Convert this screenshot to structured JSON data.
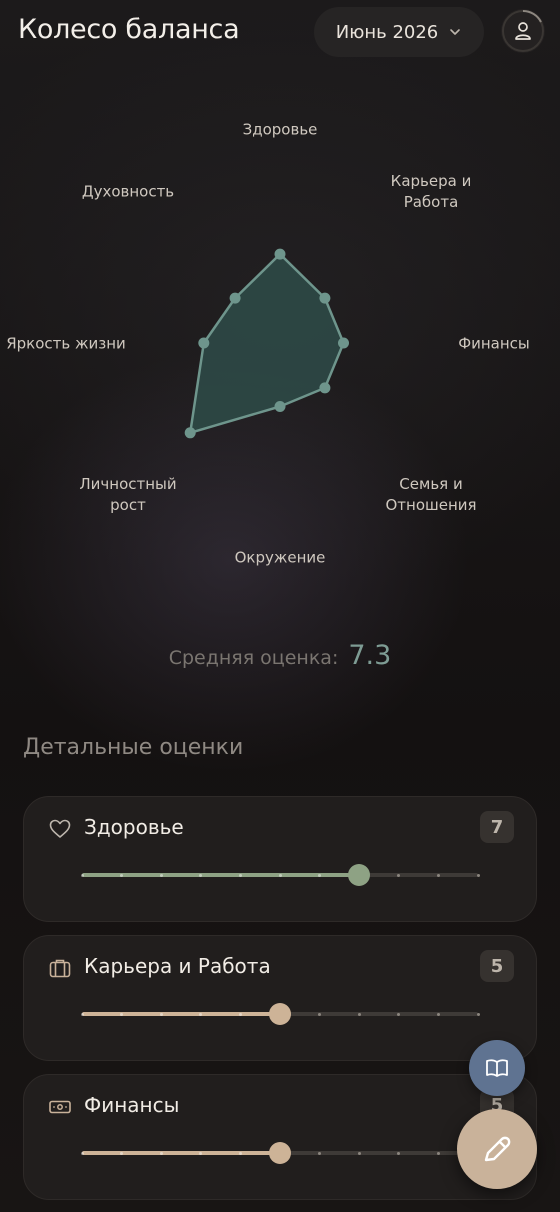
{
  "header": {
    "title": "Колесо баланса",
    "month": "Июнь 2026"
  },
  "radar": {
    "axes": [
      {
        "label": "Здоровье",
        "value": 7
      },
      {
        "label": "Карьера и\nРабота",
        "value": 5
      },
      {
        "label": "Финансы",
        "value": 5
      },
      {
        "label": "Семья и\nОтношения",
        "value": 5
      },
      {
        "label": "Окружение",
        "value": 5
      },
      {
        "label": "Личностный\nрост",
        "value": 10
      },
      {
        "label": "Яркость жизни",
        "value": 6
      },
      {
        "label": "Духовность",
        "value": 5
      }
    ],
    "max": 10,
    "fill_color": "#2e4946",
    "stroke_color": "#6e958c"
  },
  "summary": {
    "label": "Средняя оценка:",
    "value": "7.3"
  },
  "details": {
    "title": "Детальные оценки",
    "items": [
      {
        "name": "Здоровье",
        "score": 7,
        "icon": "heart-icon",
        "color": "#8ea284"
      },
      {
        "name": "Карьера и Работа",
        "score": 5,
        "icon": "briefcase-icon",
        "color": "#cdb397"
      },
      {
        "name": "Финансы",
        "score": 5,
        "icon": "banknote-icon",
        "color": "#cdb397"
      }
    ]
  },
  "fabs": {
    "book": "book-icon",
    "edit": "pencil-icon"
  }
}
